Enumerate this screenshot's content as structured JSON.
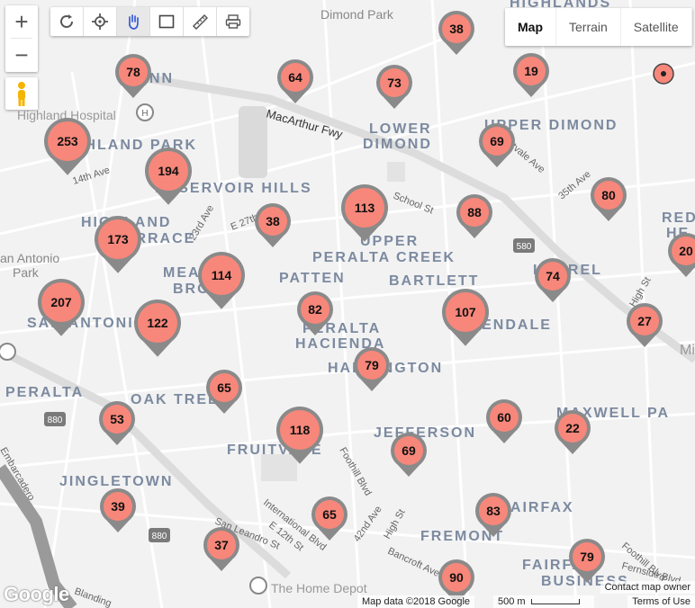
{
  "map": {
    "neighborhoods": [
      {
        "name": "Dimond Park"
      },
      {
        "name": "LYNN"
      },
      {
        "name": "Highland Hospital"
      },
      {
        "name": "HIGHLAND PARK"
      },
      {
        "name": "14th Ave"
      },
      {
        "name": "RESERVOIR HILLS"
      },
      {
        "name": "HIGHLAND"
      },
      {
        "name": "TERRACE"
      },
      {
        "name": "an Antonio"
      },
      {
        "name": "Park"
      },
      {
        "name": "MEADOW"
      },
      {
        "name": "BROOK"
      },
      {
        "name": "SAN ANTONIO"
      },
      {
        "name": "PATTEN"
      },
      {
        "name": "UPPER"
      },
      {
        "name": "PERALTA CREEK"
      },
      {
        "name": "BARTLETT"
      },
      {
        "name": "PERALTA"
      },
      {
        "name": "HACIENDA"
      },
      {
        "name": "HARRINGTON"
      },
      {
        "name": "ALLENDALE"
      },
      {
        "name": "LAUREL"
      },
      {
        "name": "LOWER"
      },
      {
        "name": "DIMOND"
      },
      {
        "name": "UPPER DIMOND"
      },
      {
        "name": "HIGHLANDS"
      },
      {
        "name": "PERALTA"
      },
      {
        "name": "OAK TREE"
      },
      {
        "name": "FRUITVALE"
      },
      {
        "name": "JEFFERSON"
      },
      {
        "name": "MAXWELL PA"
      },
      {
        "name": "JINGLETOWN"
      },
      {
        "name": "FAIRFAX"
      },
      {
        "name": "FREMONT"
      },
      {
        "name": "FAIRFAX"
      },
      {
        "name": "BUSINESS"
      },
      {
        "name": "The Home Depot"
      },
      {
        "name": "RED"
      },
      {
        "name": "HE"
      },
      {
        "name": "Mi"
      }
    ],
    "roads": [
      {
        "name": "MacArthur Fwy"
      },
      {
        "name": "School St"
      },
      {
        "name": "E 27th St"
      },
      {
        "name": "23rd Ave"
      },
      {
        "name": "35th Ave"
      },
      {
        "name": "Fruitvale Ave"
      },
      {
        "name": "Foothill Blvd"
      },
      {
        "name": "International Blvd"
      },
      {
        "name": "E 12th St"
      },
      {
        "name": "42nd Ave"
      },
      {
        "name": "High St"
      },
      {
        "name": "Bancroft Ave"
      },
      {
        "name": "San Leandro St"
      },
      {
        "name": "Embarcadero"
      },
      {
        "name": "Blanding"
      },
      {
        "name": "Foothill Blvd"
      },
      {
        "name": "High St"
      },
      {
        "name": "Fernside Blvd"
      }
    ],
    "shields": [
      "880",
      "880",
      "580"
    ],
    "clusters": [
      {
        "count": "78"
      },
      {
        "count": "64"
      },
      {
        "count": "73"
      },
      {
        "count": "38"
      },
      {
        "count": "19"
      },
      {
        "count": "253"
      },
      {
        "count": "194"
      },
      {
        "count": "69"
      },
      {
        "count": "80"
      },
      {
        "count": "38"
      },
      {
        "count": "113"
      },
      {
        "count": "88"
      },
      {
        "count": "173"
      },
      {
        "count": "114"
      },
      {
        "count": "74"
      },
      {
        "count": "20"
      },
      {
        "count": "207"
      },
      {
        "count": "122"
      },
      {
        "count": "82"
      },
      {
        "count": "107"
      },
      {
        "count": "27"
      },
      {
        "count": "79"
      },
      {
        "count": "65"
      },
      {
        "count": "53"
      },
      {
        "count": "118"
      },
      {
        "count": "60"
      },
      {
        "count": "69"
      },
      {
        "count": "22"
      },
      {
        "count": "39"
      },
      {
        "count": "65"
      },
      {
        "count": "83"
      },
      {
        "count": "37"
      },
      {
        "count": "90"
      },
      {
        "count": "79"
      }
    ]
  },
  "controls": {
    "zoom_in": "+",
    "zoom_out": "−",
    "map_types": [
      {
        "label": "Map",
        "selected": true
      },
      {
        "label": "Terrain"
      },
      {
        "label": "Satellite"
      }
    ]
  },
  "footer": {
    "logo": "Google",
    "attribution": "Map data ©2018 Google",
    "scale": "500 m",
    "terms": "Terms of Use",
    "report": "Contact map owner"
  },
  "colors": {
    "cluster_fill": "#f7877a",
    "cluster_border": "#8a8a8a",
    "land": "#f2f2f2",
    "label": "#7c8aa0",
    "freeway": "#d9d9d9"
  }
}
